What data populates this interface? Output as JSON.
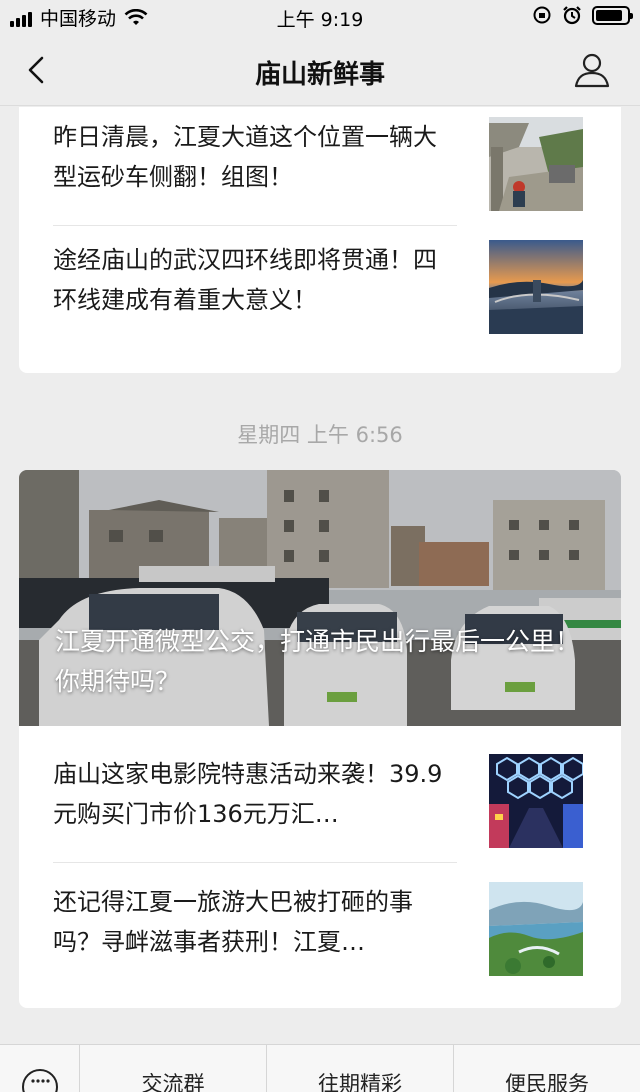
{
  "status_bar": {
    "carrier": "中国移动",
    "time": "上午 9:19",
    "battery_level": 0.85
  },
  "nav": {
    "title": "庙山新鲜事",
    "back_icon": "chevron-left-icon",
    "profile_icon": "person-icon"
  },
  "group1": {
    "articles": [
      {
        "title": "昨日清晨，江夏大道这个位置一辆大型运砂车侧翻！组图！"
      },
      {
        "title": "途经庙山的武汉四环线即将贯通！四环线建成有着重大意义！"
      }
    ]
  },
  "timestamp": "星期四 上午 6:56",
  "group2": {
    "hero_title": "江夏开通微型公交，打通市民出行最后一公里！你期待吗？",
    "articles": [
      {
        "title": "庙山这家电影院特惠活动来袭！39.9元购买门市价136元万汇…"
      },
      {
        "title": "还记得江夏一旅游大巴被打砸的事吗？寻衅滋事者获刑！江夏…"
      }
    ]
  },
  "bottom_menu": {
    "keyboard_icon": "keyboard-icon",
    "items": [
      {
        "label": "交流群"
      },
      {
        "label": "往期精彩"
      },
      {
        "label": "便民服务"
      }
    ]
  }
}
